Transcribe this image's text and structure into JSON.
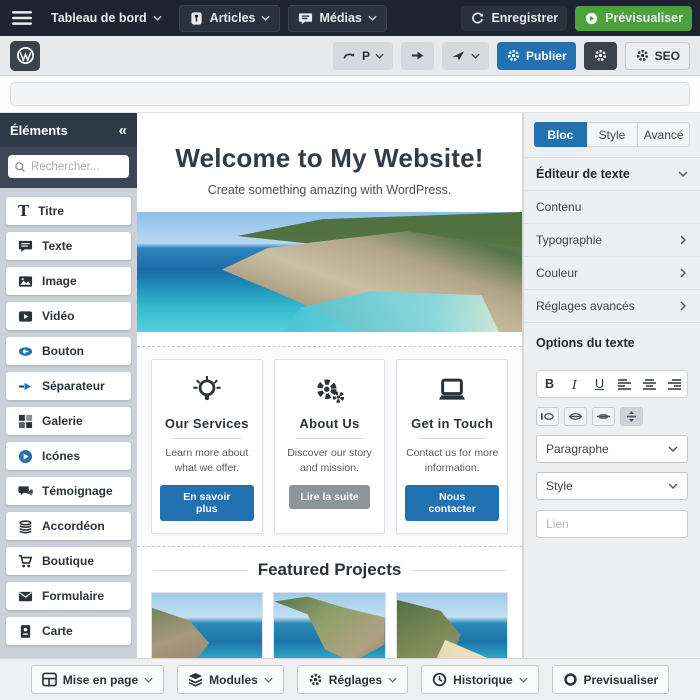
{
  "admin_bar": {
    "dashboard_label": "Tableau de bord",
    "articles_label": "Articles",
    "medias_label": "Médias",
    "save_label": "Enregistrer",
    "preview_label": "Prévisualiser"
  },
  "toolbar": {
    "p_label": "P",
    "publish_label": "Publier",
    "seo_label": "SEO"
  },
  "title_bar": {
    "value": ""
  },
  "elements_panel": {
    "title": "Éléments",
    "collapse_icon": "chevrons-left-icon",
    "search_placeholder": "Rechercher...",
    "items": [
      {
        "label": "Titre",
        "icon": "heading-t-icon"
      },
      {
        "label": "Texte",
        "icon": "text-bubble-icon"
      },
      {
        "label": "Image",
        "icon": "image-icon"
      },
      {
        "label": "Vidéo",
        "icon": "video-play-icon"
      },
      {
        "label": "Bouton",
        "icon": "button-pill-icon"
      },
      {
        "label": "Séparateur",
        "icon": "separator-arrow-icon"
      },
      {
        "label": "Galerie",
        "icon": "gallery-grid-icon"
      },
      {
        "label": "Icónes",
        "icon": "icon-circle-icon"
      },
      {
        "label": "Témoignage",
        "icon": "testimonial-bubbles-icon"
      },
      {
        "label": "Accordéon",
        "icon": "accordion-stack-icon"
      },
      {
        "label": "Boutique",
        "icon": "cart-icon"
      },
      {
        "label": "Formulaire",
        "icon": "envelope-icon"
      },
      {
        "label": "Carte",
        "icon": "contact-card-icon"
      }
    ]
  },
  "canvas": {
    "hero_title": "Welcome to My Website!",
    "hero_subtitle": "Create something amazing with WordPress.",
    "hero_image": "coastal-cliffs-photo",
    "cards": [
      {
        "icon": "lightbulb-icon",
        "title": "Our Services",
        "text": "Learn more about what we offer.",
        "button": "En savoir plus",
        "button_style": "primary"
      },
      {
        "icon": "gears-icon",
        "title": "About Us",
        "text": "Discover our story and mission.",
        "button": "Lire la suite",
        "button_style": "secondary"
      },
      {
        "icon": "laptop-icon",
        "title": "Get in Touch",
        "text": "Contact us for more information.",
        "button": "Nous contacter",
        "button_style": "primary"
      }
    ],
    "featured_title": "Featured Projects",
    "project_images": [
      "cove-photo",
      "bay-photo",
      "beach-photo"
    ]
  },
  "settings_panel": {
    "tabs": [
      {
        "label": "Bloc",
        "active": true
      },
      {
        "label": "Style",
        "active": false
      },
      {
        "label": "Avancé",
        "active": false
      }
    ],
    "sections": [
      {
        "label": "Éditeur de texte",
        "chevron": "down",
        "bold": true
      },
      {
        "label": "Contenu",
        "chevron": "none",
        "bold": false
      },
      {
        "label": "Typographie",
        "chevron": "right",
        "bold": false
      },
      {
        "label": "Couleur",
        "chevron": "right",
        "bold": false
      },
      {
        "label": "Réglages avancés",
        "chevron": "right",
        "bold": false
      }
    ],
    "text_options_title": "Options du texte",
    "format_buttons": {
      "bold": "B",
      "italic": "I",
      "underline": "U"
    },
    "align_icons": [
      "align-left-icon",
      "align-center-icon",
      "align-right-icon"
    ],
    "mini_icons": [
      "float-left-icon",
      "float-center-icon",
      "float-right-icon",
      "vertical-align-icon"
    ],
    "paragraph_select": "Paragraphe",
    "style_select": "Style",
    "link_placeholder": "Lien"
  },
  "bottom_bar": {
    "buttons": [
      {
        "label": "Mise en page",
        "icon": "layout-icon",
        "caret": true
      },
      {
        "label": "Modules",
        "icon": "layers-icon",
        "caret": true
      },
      {
        "label": "Réglages",
        "icon": "gear-icon",
        "caret": true
      },
      {
        "label": "Historique",
        "icon": "clock-icon",
        "caret": true
      },
      {
        "label": "Previsualiser",
        "icon": "circle-icon",
        "caret": false
      }
    ]
  },
  "colors": {
    "accent_blue": "#2271b1",
    "preview_green": "#4ca13c",
    "admin_dark": "#1d2430",
    "panel_bg": "#edeff1",
    "sidebar_bg": "#ccd1d7"
  }
}
